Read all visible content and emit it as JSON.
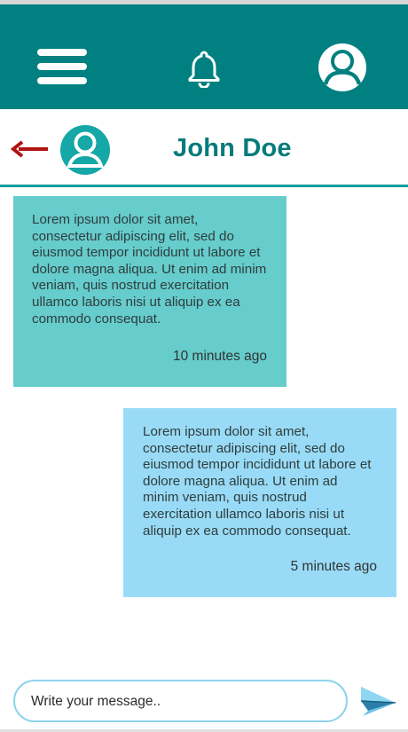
{
  "appbar": {
    "menu_icon": "hamburger-menu-icon",
    "notification_icon": "bell-icon",
    "profile_icon": "user-avatar-icon",
    "bg_color": "#008080"
  },
  "chat_header": {
    "back_icon": "arrow-left-icon",
    "contact_avatar_icon": "user-avatar-icon",
    "contact_name": "John Doe",
    "name_color": "#077b7b",
    "back_color": "#b01313"
  },
  "messages": [
    {
      "direction": "incoming",
      "text": "Lorem ipsum dolor sit amet, consectetur adipiscing elit, sed do eiusmod tempor incididunt ut labore et dolore magna aliqua. Ut enim ad minim veniam, quis nostrud exercitation ullamco laboris nisi ut aliquip ex ea commodo consequat.",
      "time": "10 minutes ago",
      "bg_color": "#66cccc"
    },
    {
      "direction": "outgoing",
      "text": "Lorem ipsum dolor sit amet, consectetur adipiscing elit, sed do eiusmod tempor incididunt ut labore et dolore magna aliqua. Ut enim ad minim veniam, quis nostrud exercitation ullamco laboris nisi ut aliquip ex ea commodo consequat.",
      "time": "5 minutes ago",
      "bg_color": "#99dbf6"
    }
  ],
  "composer": {
    "placeholder": "Write your message..",
    "value": "",
    "send_icon": "paper-plane-send-icon"
  }
}
